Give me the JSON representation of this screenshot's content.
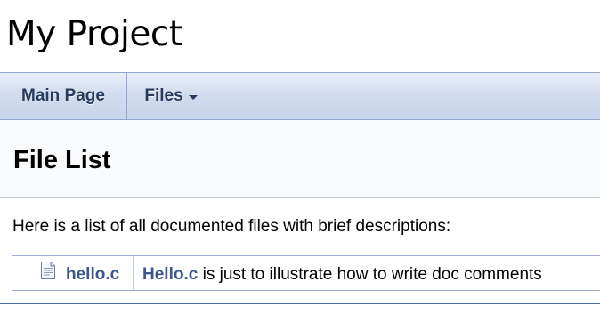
{
  "project": {
    "name": "My Project"
  },
  "nav": {
    "main_page_label": "Main Page",
    "files_label": "Files",
    "files_icon": "caret-down-icon"
  },
  "page": {
    "title": "File List",
    "description": "Here is a list of all documented files with brief descriptions:"
  },
  "files": [
    {
      "icon": "file-icon",
      "name": "hello.c",
      "brief_link": "Hello.c",
      "brief_text": " is just to illustrate how to write doc comments"
    }
  ],
  "colors": {
    "link": "#3d578c",
    "nav_text": "#283a5d",
    "nav_border": "#93a6cf",
    "footer_rule": "#4a6aaa"
  }
}
